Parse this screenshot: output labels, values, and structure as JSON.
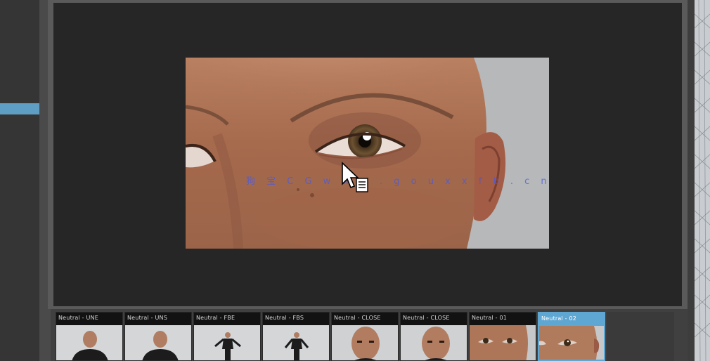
{
  "watermark": "狗 宝 C G   w w w . g o u x x f b . c n",
  "thumbnails": [
    {
      "label": "Neutral - UNE",
      "kind": "bust",
      "selected": false
    },
    {
      "label": "Neutral - UNS",
      "kind": "bust",
      "selected": false
    },
    {
      "label": "Neutral - FBE",
      "kind": "full",
      "selected": false
    },
    {
      "label": "Neutral - FBS",
      "kind": "full",
      "selected": false
    },
    {
      "label": "Neutral - CLOSE",
      "kind": "face",
      "selected": false
    },
    {
      "label": "Neutral - CLOSE",
      "kind": "face",
      "selected": false
    },
    {
      "label": "Neutral - 01",
      "kind": "eye",
      "selected": false
    },
    {
      "label": "Neutral - 02",
      "kind": "eye",
      "selected": true
    }
  ],
  "colors": {
    "accent": "#5fa7d3",
    "viewer_bg": "#262626",
    "panel": "#353535"
  }
}
